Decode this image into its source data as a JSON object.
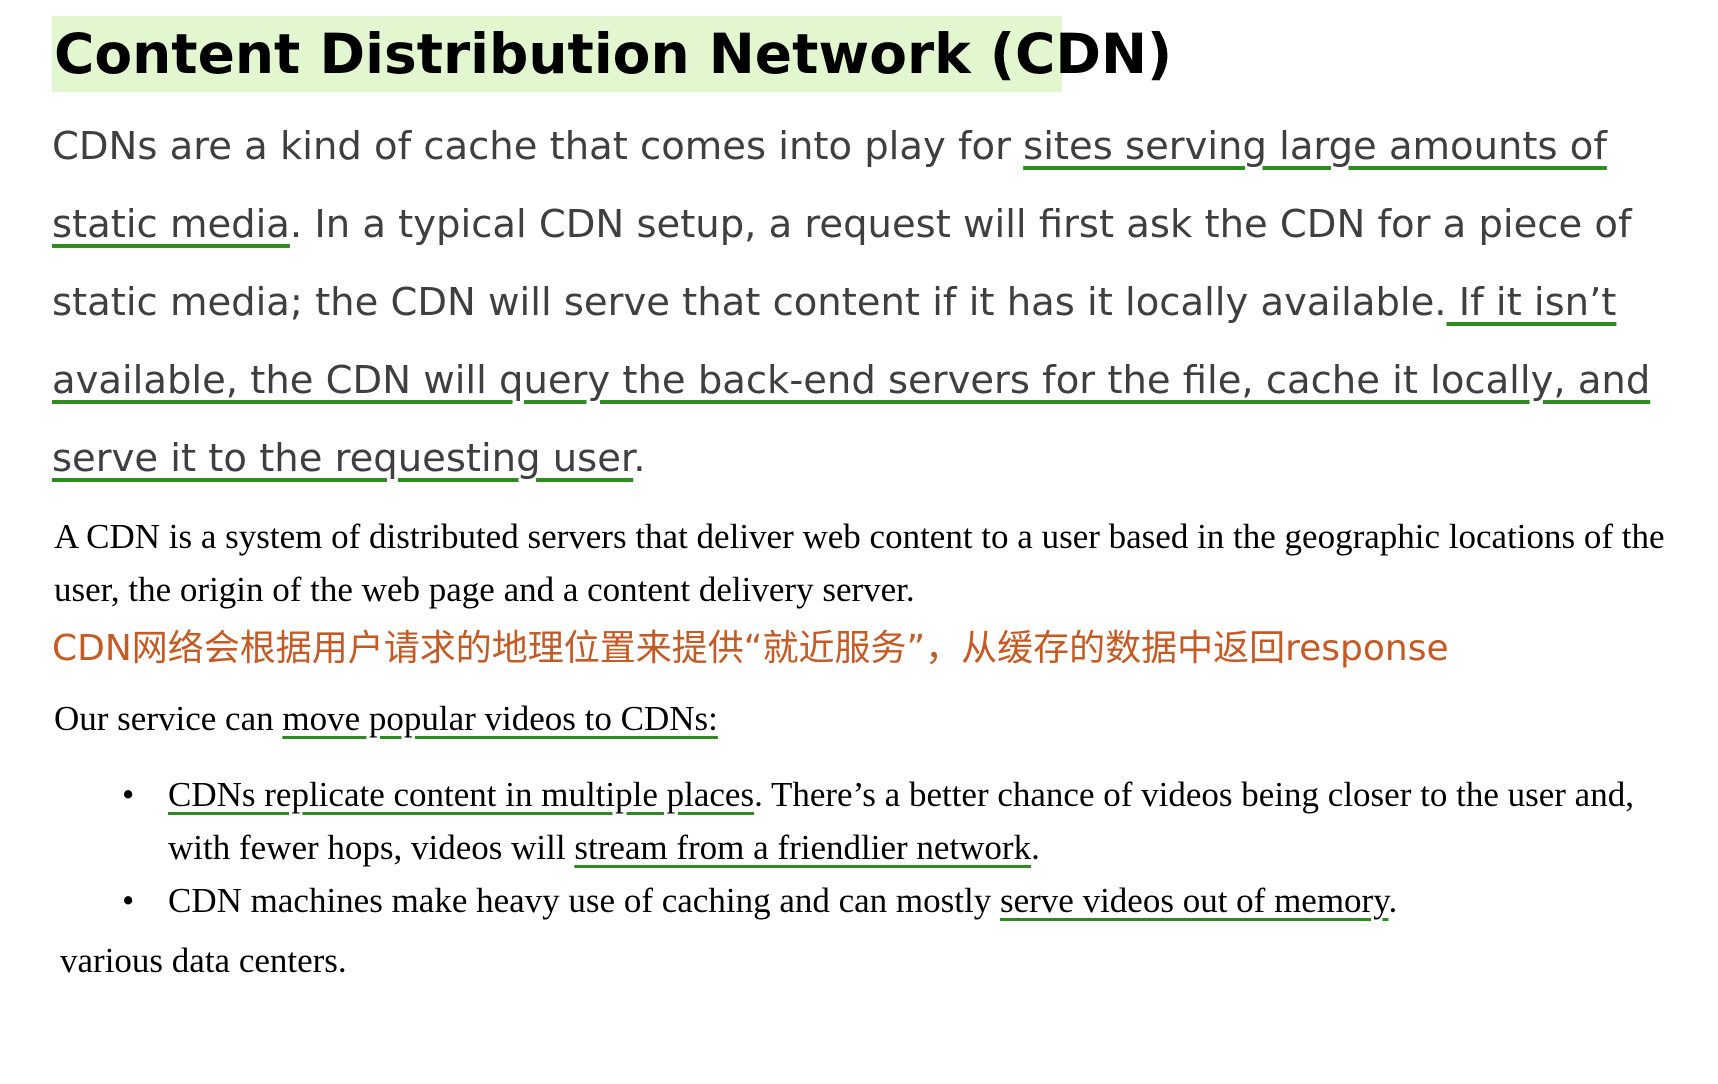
{
  "title": "Content Distribution Network (CDN)",
  "intro": {
    "t1": "CDNs are a kind of cache that comes into play for ",
    "h1": "sites serving large amounts of static media",
    "t2": ". In a typical CDN setup, a request will first ask the CDN for a piece of static media; the CDN will serve that content if it has it locally available.",
    "h2": " If it isn’t available, the CDN will query the back-end servers for the file, cache it locally, and serve it to the requesting user",
    "t3": "."
  },
  "definition": "A CDN is a system of distributed servers that deliver web content to a user based in the geographic locations of the user, the origin of the web page and a content delivery server.",
  "chinese_note": "CDN网络会根据用户请求的地理位置来提供“就近服务”，从缓存的数据中返回response",
  "service": {
    "t1": "Our service can ",
    "u1": "move popular videos to CDNs:"
  },
  "bullets": [
    {
      "marker": "•",
      "u1": "CDNs replicate content in multiple places",
      "t1": ". There’s a better chance of videos being closer to the user and, with fewer hops, videos will ",
      "u2": "stream from a friendlier network",
      "t2": "."
    },
    {
      "marker": "•",
      "t1": "CDN machines make heavy use of caching and can mostly ",
      "u1": "serve videos out of memory",
      "t2": "."
    }
  ],
  "tail": "various data centers.",
  "colors": {
    "title_highlight": "#e2f7cf",
    "underline_green": "#2e8b22",
    "chinese_orange": "#c45a24",
    "intro_gray": "#3f3f3f"
  }
}
